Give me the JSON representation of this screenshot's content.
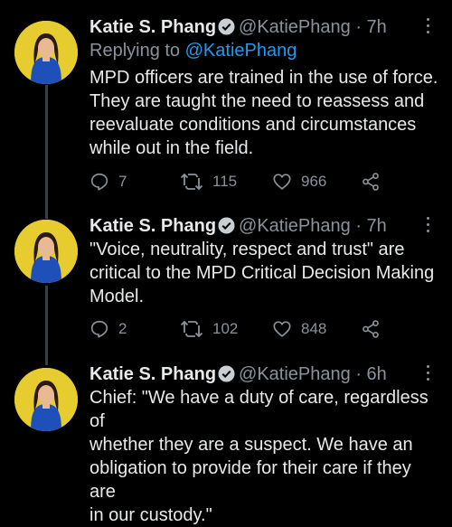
{
  "tweets": [
    {
      "name": "Katie S. Phang",
      "handle": "@KatiePhang",
      "time": "· 7h",
      "replying_prefix": "Replying to ",
      "replying_to": "@KatiePhang",
      "text": "MPD officers are trained in the use of force.\nThey are taught the need to reassess and\nreevaluate conditions and circumstances\nwhile out in the field.",
      "replies": "7",
      "retweets": "115",
      "likes": "966"
    },
    {
      "name": "Katie S. Phang",
      "handle": "@KatiePhang",
      "time": "· 7h",
      "text": "\"Voice, neutrality, respect and trust\" are\ncritical to the MPD Critical Decision Making\nModel.",
      "replies": "2",
      "retweets": "102",
      "likes": "848"
    },
    {
      "name": "Katie S. Phang",
      "handle": "@KatiePhang",
      "time": "· 6h",
      "text": "Chief: \"We have a duty of care, regardless of\nwhether they are a suspect.  We have an\nobligation to provide for their care if they are\nin our custody.\""
    }
  ],
  "colors": {
    "background": "#000000",
    "avatar_bg": "#e6cc2e",
    "link": "#1d9bf0",
    "muted": "#8b9299",
    "verified": "#c9ced3"
  },
  "icons": [
    "verified-badge-icon",
    "more-icon",
    "reply-icon",
    "retweet-icon",
    "like-icon",
    "share-icon"
  ]
}
